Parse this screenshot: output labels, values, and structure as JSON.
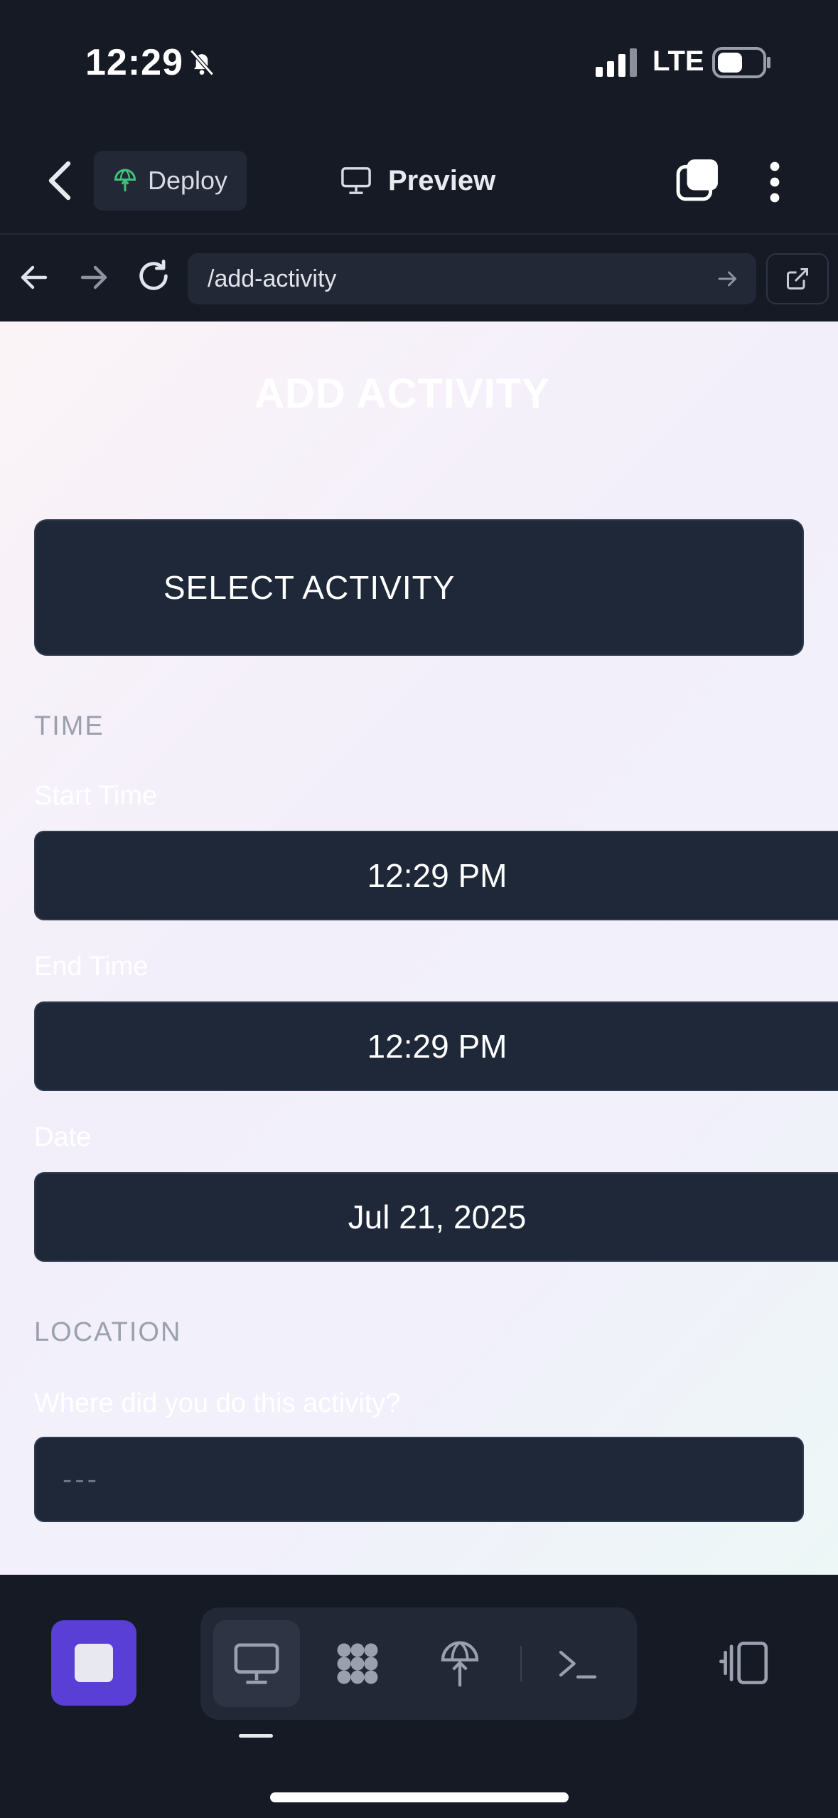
{
  "status": {
    "time": "12:29",
    "network": "LTE"
  },
  "app_bar": {
    "deploy_label": "Deploy",
    "preview_label": "Preview"
  },
  "browser": {
    "url": "/add-activity"
  },
  "page": {
    "title": "ADD ACTIVITY",
    "select_activity_label": "SELECT ACTIVITY",
    "time_section": "TIME",
    "start_time_label": "Start Time",
    "start_time_value": "12:29 PM",
    "end_time_label": "End Time",
    "end_time_value": "12:29 PM",
    "date_label": "Date",
    "date_value": "Jul 21, 2025",
    "location_section": "LOCATION",
    "location_question": "Where did you do this activity?",
    "location_placeholder": "---"
  },
  "colors": {
    "accent": "#5a3fd6",
    "dark_bg": "#161a24",
    "field_bg": "#1f2839",
    "deploy_green": "#3ec37a"
  }
}
